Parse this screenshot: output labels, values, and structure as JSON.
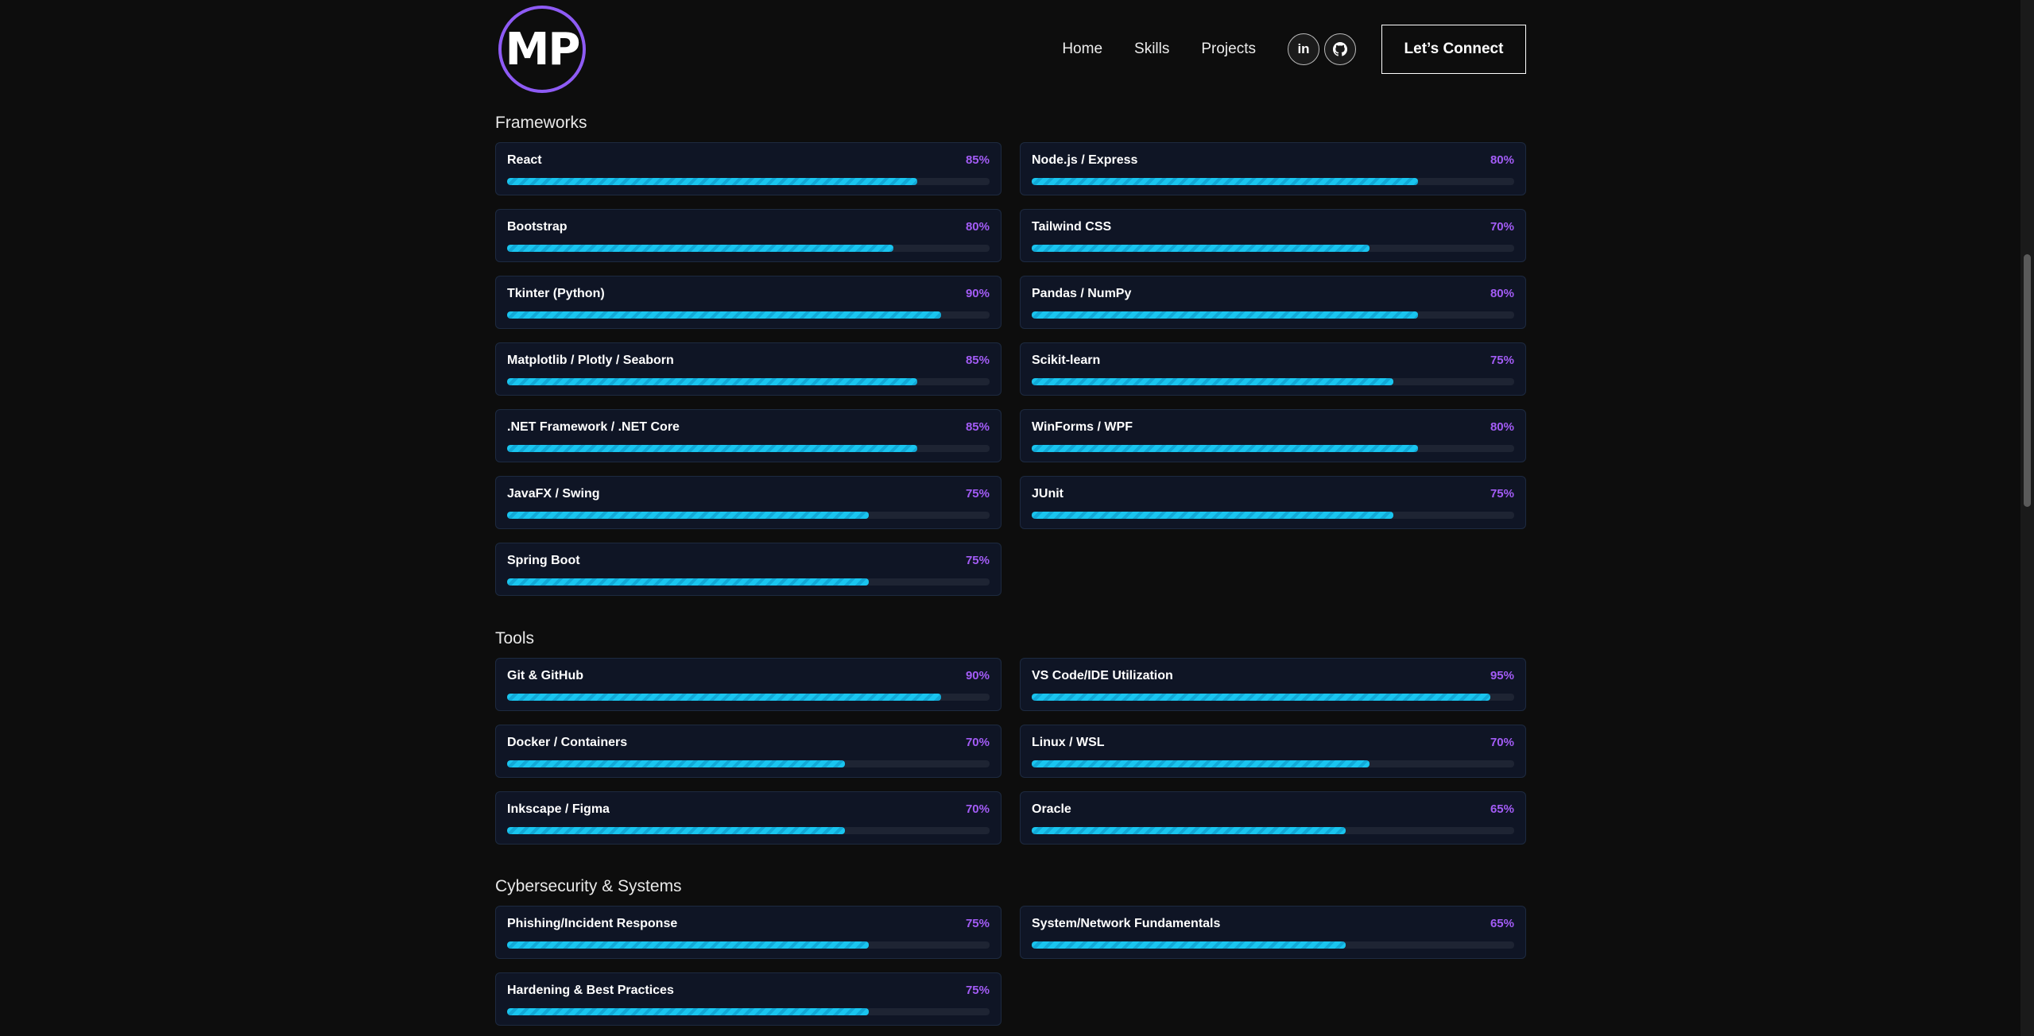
{
  "header": {
    "logo_text": "MP",
    "nav": [
      "Home",
      "Skills",
      "Projects"
    ],
    "social": [
      {
        "icon": "linkedin-icon",
        "glyph": "in"
      },
      {
        "icon": "github-icon",
        "glyph": "◉"
      }
    ],
    "connect_label": "Let’s Connect"
  },
  "colors": {
    "background": "#0d0d0d",
    "accent_purple": "#a35cf6",
    "bar_cyan": "#19c5ef",
    "card_bg": "#0f1525"
  },
  "sections": [
    {
      "title": "Frameworks",
      "skills": [
        {
          "name": "React",
          "percent_label": "85%",
          "level": 85
        },
        {
          "name": "Node.js / Express",
          "percent_label": "80%",
          "level": 80
        },
        {
          "name": "Bootstrap",
          "percent_label": "80%",
          "level": 80
        },
        {
          "name": "Tailwind CSS",
          "percent_label": "70%",
          "level": 70
        },
        {
          "name": "Tkinter (Python)",
          "percent_label": "90%",
          "level": 90
        },
        {
          "name": "Pandas / NumPy",
          "percent_label": "80%",
          "level": 80
        },
        {
          "name": "Matplotlib / Plotly / Seaborn",
          "percent_label": "85%",
          "level": 85
        },
        {
          "name": "Scikit-learn",
          "percent_label": "75%",
          "level": 75
        },
        {
          "name": ".NET Framework / .NET Core",
          "percent_label": "85%",
          "level": 85
        },
        {
          "name": "WinForms / WPF",
          "percent_label": "80%",
          "level": 80
        },
        {
          "name": "JavaFX / Swing",
          "percent_label": "75%",
          "level": 75
        },
        {
          "name": "JUnit",
          "percent_label": "75%",
          "level": 75
        },
        {
          "name": "Spring Boot",
          "percent_label": "75%",
          "level": 75
        }
      ]
    },
    {
      "title": "Tools",
      "skills": [
        {
          "name": "Git & GitHub",
          "percent_label": "90%",
          "level": 90
        },
        {
          "name": "VS Code/IDE Utilization",
          "percent_label": "95%",
          "level": 95
        },
        {
          "name": "Docker / Containers",
          "percent_label": "70%",
          "level": 70
        },
        {
          "name": "Linux / WSL",
          "percent_label": "70%",
          "level": 70
        },
        {
          "name": "Inkscape / Figma",
          "percent_label": "70%",
          "level": 70
        },
        {
          "name": "Oracle",
          "percent_label": "65%",
          "level": 65
        }
      ]
    },
    {
      "title": "Cybersecurity & Systems",
      "skills": [
        {
          "name": "Phishing/Incident Response",
          "percent_label": "75%",
          "level": 75
        },
        {
          "name": "System/Network Fundamentals",
          "percent_label": "65%",
          "level": 65
        },
        {
          "name": "Hardening & Best Practices",
          "percent_label": "75%",
          "level": 75
        }
      ]
    }
  ]
}
